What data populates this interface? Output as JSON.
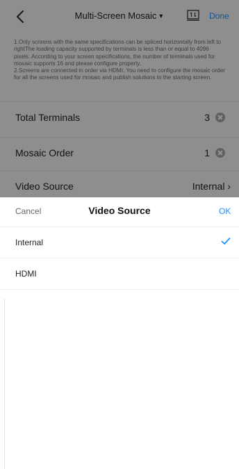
{
  "header": {
    "title": "Multi-Screen Mosaic",
    "done_label": "Done"
  },
  "info": {
    "line1": "1.Only screens with the same specifications can be spliced horizontally from left to rightThe loading capacity supported by terminals is less than or equal to 4096 pixels. According to your screen specifications, the number of terminals used for mosaic supports 16 and please configure properly.",
    "line2": "2.Screens are connected in order via HDMI. You need to configure the mosaic order for all the screens used for mosaic and publish solutions to the starting screen."
  },
  "fields": {
    "total_terminals": {
      "label": "Total Terminals",
      "value": "3"
    },
    "mosaic_order": {
      "label": "Mosaic Order",
      "value": "1"
    },
    "video_source": {
      "label": "Video Source",
      "value": "Internal"
    }
  },
  "picker": {
    "cancel_label": "Cancel",
    "title": "Video Source",
    "ok_label": "OK",
    "options": [
      {
        "label": "Internal",
        "selected": true
      },
      {
        "label": "HDMI",
        "selected": false
      }
    ]
  },
  "colors": {
    "accent": "#1e90ff"
  }
}
